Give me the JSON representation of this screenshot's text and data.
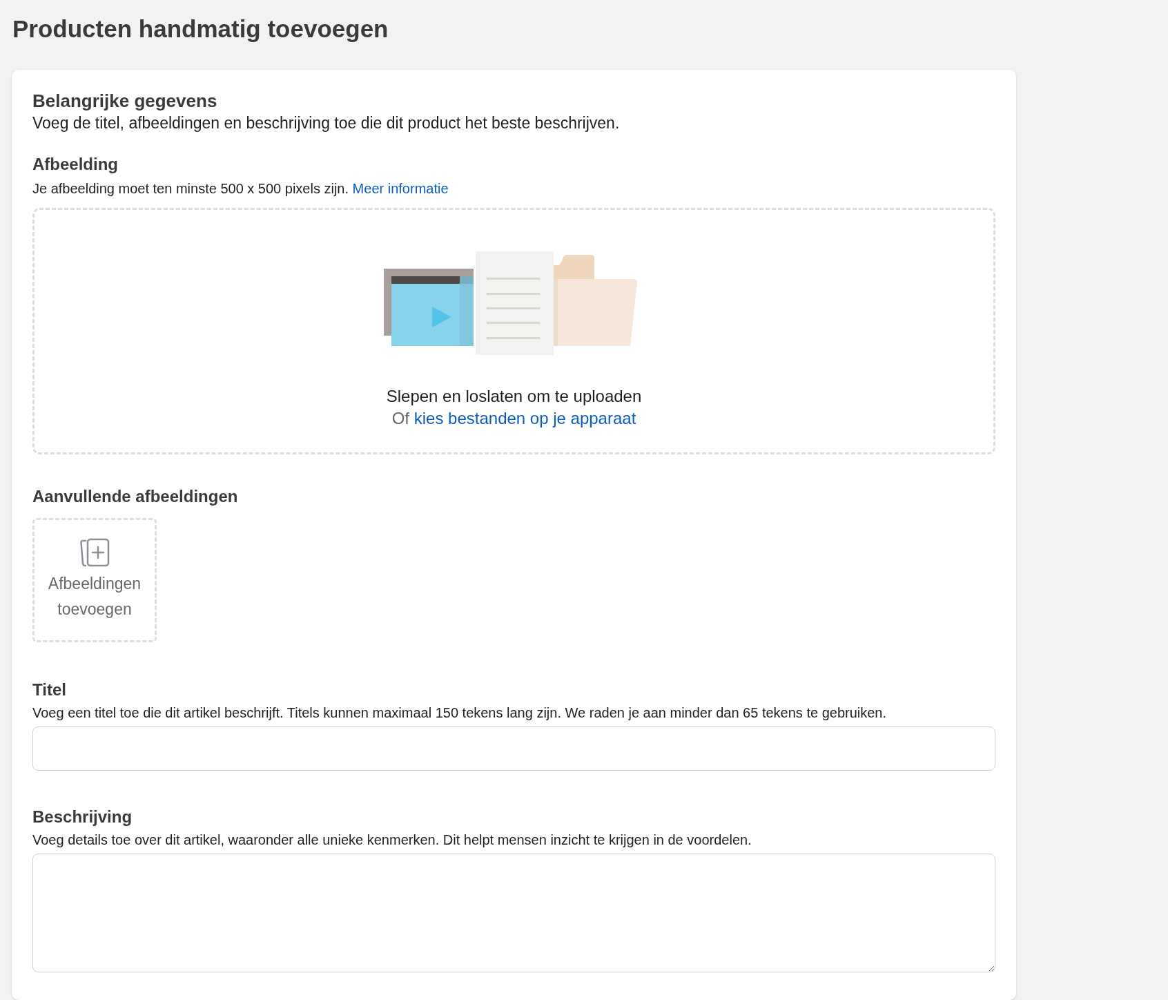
{
  "page_title": "Producten handmatig toevoegen",
  "section": {
    "heading": "Belangrijke gegevens",
    "subtitle": "Voeg de titel, afbeeldingen en beschrijving toe die dit product het beste beschrijven."
  },
  "image": {
    "label": "Afbeelding",
    "hint": "Je afbeelding moet ten minste 500 x 500 pixels zijn.",
    "hint_link": "Meer informatie",
    "drop_text": "Slepen en loslaten om te uploaden",
    "or_text": "Of",
    "choose_link": "kies bestanden op je apparaat"
  },
  "extra_images": {
    "label": "Aanvullende afbeeldingen",
    "add_button": "Afbeeldingen toevoegen"
  },
  "title_field": {
    "label": "Titel",
    "hint": "Voeg een titel toe die dit artikel beschrijft. Titels kunnen maximaal 150 tekens lang zijn. We raden je aan minder dan 65 tekens te gebruiken."
  },
  "description_field": {
    "label": "Beschrijving",
    "hint": "Voeg details toe over dit artikel, waaronder alle unieke kenmerken. Dit helpt mensen inzicht te krijgen in de voordelen."
  }
}
